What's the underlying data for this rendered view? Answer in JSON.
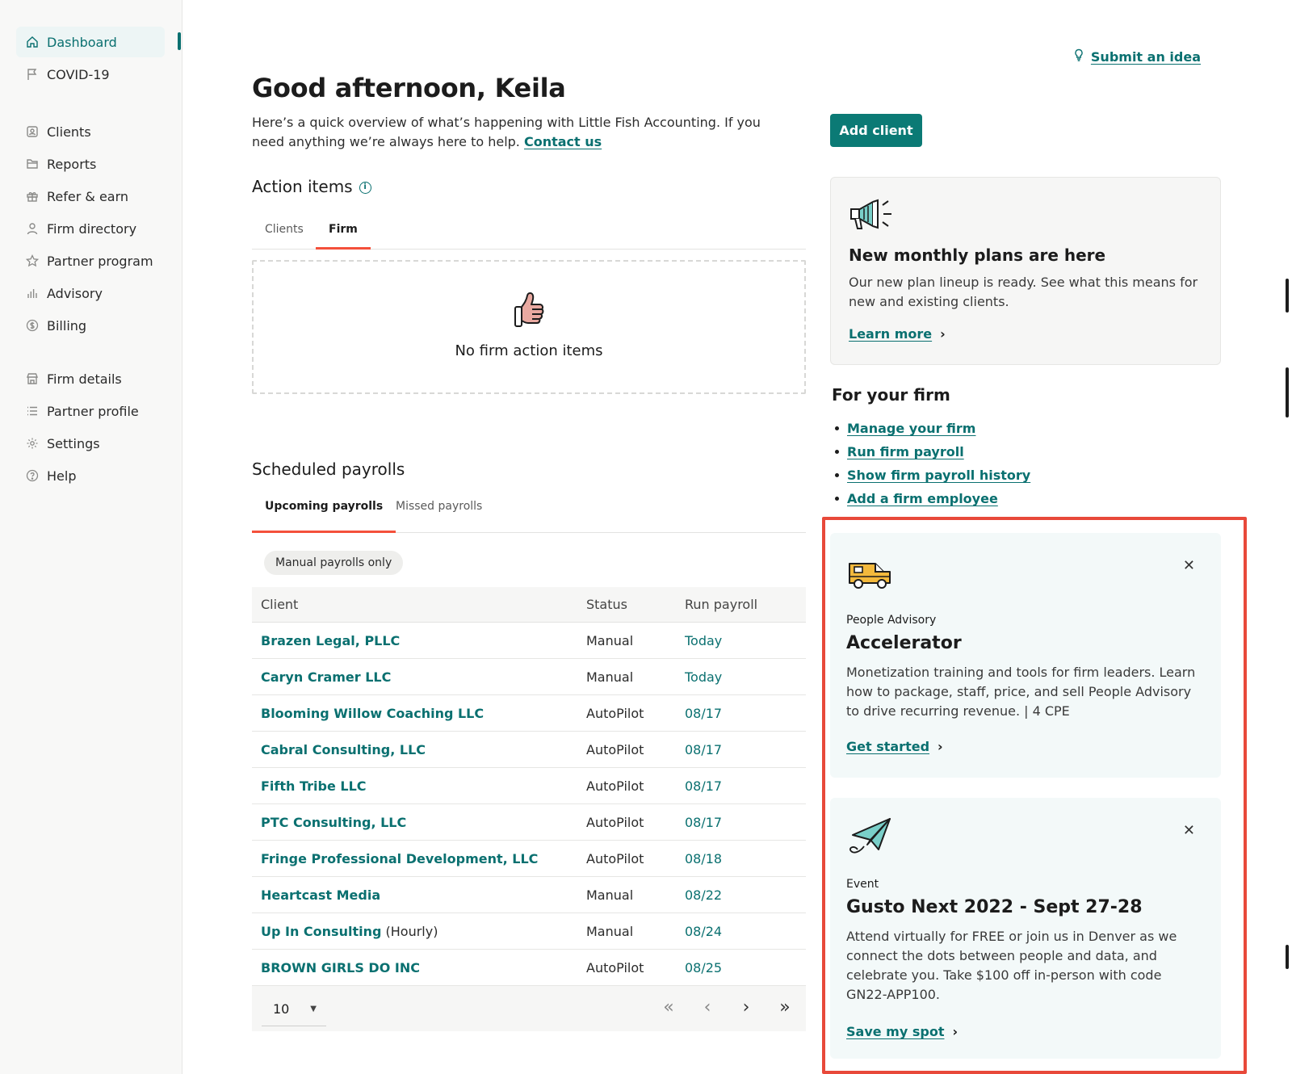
{
  "sidebar": {
    "group1": [
      {
        "label": "Dashboard",
        "icon": "home-icon",
        "active": true
      },
      {
        "label": "COVID-19",
        "icon": "flag-icon"
      }
    ],
    "group2": [
      {
        "label": "Clients",
        "icon": "client-icon"
      },
      {
        "label": "Reports",
        "icon": "folder-icon"
      },
      {
        "label": "Refer & earn",
        "icon": "gift-icon"
      },
      {
        "label": "Firm directory",
        "icon": "person-icon"
      },
      {
        "label": "Partner program",
        "icon": "star-icon"
      },
      {
        "label": "Advisory",
        "icon": "bar-chart-icon"
      },
      {
        "label": "Billing",
        "icon": "dollar-icon"
      }
    ],
    "group3": [
      {
        "label": "Firm details",
        "icon": "store-icon"
      },
      {
        "label": "Partner profile",
        "icon": "list-icon"
      },
      {
        "label": "Settings",
        "icon": "gear-icon"
      },
      {
        "label": "Help",
        "icon": "question-icon"
      }
    ]
  },
  "header": {
    "submit_idea": "Submit an idea",
    "greeting": "Good afternoon, Keila",
    "intro": "Here’s a quick overview of what’s happening with Little Fish Accounting. If you need anything we’re always here to help.",
    "contact": "Contact us",
    "add_client": "Add client"
  },
  "action_items": {
    "title": "Action items",
    "tabs": [
      "Clients",
      "Firm"
    ],
    "active_tab": "Firm",
    "empty_text": "No firm action items"
  },
  "scheduled": {
    "title": "Scheduled payrolls",
    "tabs": [
      "Upcoming payrolls",
      "Missed payrolls"
    ],
    "active_tab": "Upcoming payrolls",
    "filter_chip": "Manual payrolls only",
    "columns": [
      "Client",
      "Status",
      "Run payroll"
    ],
    "rows": [
      {
        "client": "Brazen Legal, PLLC",
        "suffix": "",
        "status": "Manual",
        "run": "Today"
      },
      {
        "client": "Caryn Cramer LLC",
        "suffix": "",
        "status": "Manual",
        "run": "Today"
      },
      {
        "client": "Blooming Willow Coaching LLC",
        "suffix": "",
        "status": "AutoPilot",
        "run": "08/17"
      },
      {
        "client": "Cabral Consulting, LLC",
        "suffix": "",
        "status": "AutoPilot",
        "run": "08/17"
      },
      {
        "client": "Fifth Tribe LLC",
        "suffix": "",
        "status": "AutoPilot",
        "run": "08/17"
      },
      {
        "client": "PTC Consulting, LLC",
        "suffix": "",
        "status": "AutoPilot",
        "run": "08/17"
      },
      {
        "client": "Fringe Professional Development, LLC",
        "suffix": "",
        "status": "AutoPilot",
        "run": "08/18"
      },
      {
        "client": "Heartcast Media",
        "suffix": "",
        "status": "Manual",
        "run": "08/22"
      },
      {
        "client": "Up In Consulting",
        "suffix": " (Hourly)",
        "status": "Manual",
        "run": "08/24"
      },
      {
        "client": "BROWN GIRLS DO INC",
        "suffix": "",
        "status": "AutoPilot",
        "run": "08/25"
      }
    ],
    "page_size": "10"
  },
  "promo": {
    "title": "New monthly plans are here",
    "body": "Our new plan lineup is ready. See what this means for new and existing clients.",
    "link": "Learn more"
  },
  "for_firm": {
    "title": "For your firm",
    "links": [
      "Manage your firm",
      "Run firm payroll",
      "Show firm payroll history",
      "Add a firm employee"
    ]
  },
  "offers": [
    {
      "eyebrow": "People Advisory",
      "title": "Accelerator",
      "body": "Monetization training and tools for firm leaders. Learn how to package, staff, price, and sell People Advisory to drive recurring revenue. | 4 CPE",
      "link": "Get started",
      "icon": "delivery-truck-icon"
    },
    {
      "eyebrow": "Event",
      "title": "Gusto Next 2022 - Sept 27-28",
      "body": "Attend virtually for FREE or join us in Denver as we connect the dots between people and data, and celebrate you. Take $100 off in-person with code GN22-APP100.",
      "link": "Save my spot",
      "icon": "paper-plane-icon"
    }
  ],
  "colors": {
    "accent": "#0a7070",
    "button": "#0b7a75",
    "tab_indicator": "#f4503b",
    "highlight": "#e8493a"
  }
}
